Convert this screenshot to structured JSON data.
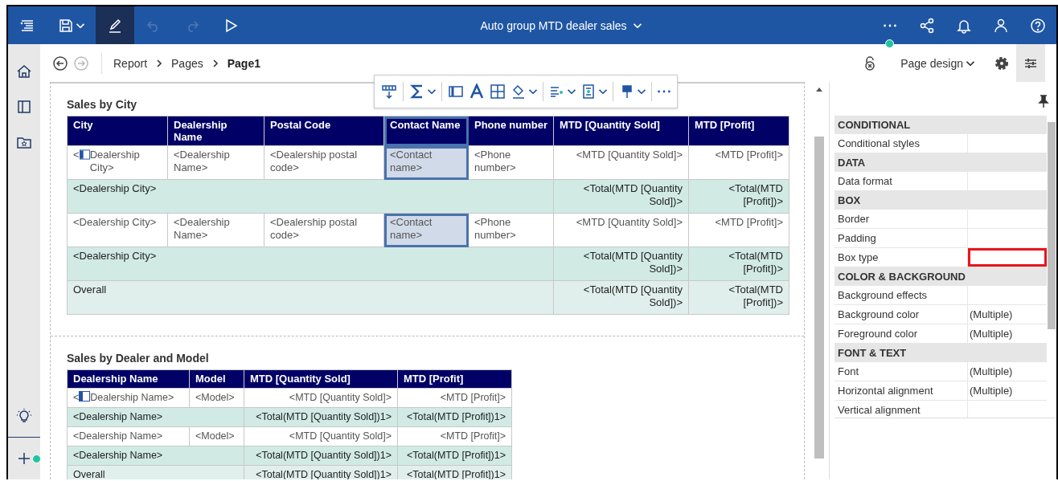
{
  "app_bar": {
    "buttons": [
      {
        "kind": "menu",
        "selected": false,
        "disabled": false
      },
      {
        "kind": "save",
        "selected": false,
        "disabled": false
      },
      {
        "kind": "edit",
        "selected": true,
        "disabled": false
      },
      {
        "kind": "undo",
        "selected": false,
        "disabled": true
      },
      {
        "kind": "redo",
        "selected": false,
        "disabled": true
      },
      {
        "kind": "run",
        "selected": false,
        "disabled": false
      }
    ],
    "title": "Auto group MTD dealer sales",
    "actions": [
      {
        "kind": "more",
        "badge": true
      },
      {
        "kind": "share",
        "badge": false
      },
      {
        "kind": "notifications",
        "badge": false
      },
      {
        "kind": "user",
        "badge": false
      },
      {
        "kind": "help",
        "badge": false
      }
    ]
  },
  "rail": [
    {
      "kind": "home",
      "badge": false
    },
    {
      "kind": "panel",
      "badge": false
    },
    {
      "kind": "folder",
      "badge": false
    },
    {
      "kind": "tip",
      "badge": false
    },
    {
      "kind": "add",
      "badge": true
    }
  ],
  "breadcrumb": {
    "back_disabled": false,
    "forward_disabled": true,
    "items": [
      {
        "label": "Report",
        "current": false
      },
      {
        "label": "Pages",
        "current": false
      },
      {
        "label": "Page1",
        "current": true
      }
    ]
  },
  "view_mode": "Page design",
  "tools": [
    {
      "kind": "unlock",
      "selected": false
    },
    {
      "kind": "settings",
      "selected": false
    },
    {
      "kind": "properties",
      "selected": true
    }
  ],
  "tables": [
    {
      "title": "Sales by City",
      "columns": [
        {
          "label": "City",
          "kind": "attribute",
          "selected": false
        },
        {
          "label": "Dealership Name",
          "kind": "attribute",
          "selected": false
        },
        {
          "label": "Postal Code",
          "kind": "attribute",
          "selected": false
        },
        {
          "label": "Contact Name",
          "kind": "attribute",
          "selected": true
        },
        {
          "label": "Phone number",
          "kind": "attribute",
          "selected": false
        },
        {
          "label": "MTD [Quantity Sold]",
          "kind": "measure",
          "selected": false
        },
        {
          "label": "MTD [Profit]",
          "kind": "measure",
          "selected": false
        }
      ],
      "rows": [
        {
          "kind": "detail",
          "cells": [
            {
              "prefix": "<",
              "text": "Dealership City>"
            },
            {
              "text": "<Dealership Name>"
            },
            {
              "text": "<Dealership postal code>"
            },
            {
              "text": "<Contact name>"
            },
            {
              "text": "<Phone number>"
            },
            {
              "text": "<MTD [Quantity Sold]>"
            },
            {
              "text": "<MTD [Profit]>"
            }
          ]
        },
        {
          "kind": "group",
          "label": "<Dealership City>",
          "totals": [
            "<Total(MTD [Quantity Sold])>",
            "<Total(MTD [Profit])>"
          ]
        },
        {
          "kind": "detail",
          "cells": [
            {
              "text": "<Dealership City>"
            },
            {
              "text": "<Dealership Name>"
            },
            {
              "text": "<Dealership postal code>"
            },
            {
              "text": "<Contact name>"
            },
            {
              "text": "<Phone number>"
            },
            {
              "text": "<MTD [Quantity Sold]>"
            },
            {
              "text": "<MTD [Profit]>"
            }
          ]
        },
        {
          "kind": "group",
          "label": "<Dealership City>",
          "totals": [
            "<Total(MTD [Quantity Sold])>",
            "<Total(MTD [Profit])>"
          ]
        },
        {
          "kind": "overall",
          "label": "Overall",
          "totals": [
            "<Total(MTD [Quantity Sold])>",
            "<Total(MTD [Profit])>"
          ]
        }
      ]
    },
    {
      "title": "Sales by Dealer and Model",
      "columns": [
        {
          "label": "Dealership Name",
          "kind": "attribute",
          "selected": false
        },
        {
          "label": "Model",
          "kind": "attribute",
          "selected": false
        },
        {
          "label": "MTD [Quantity Sold]",
          "kind": "measure",
          "selected": false
        },
        {
          "label": "MTD [Profit]",
          "kind": "measure",
          "selected": false
        }
      ],
      "rows": [
        {
          "kind": "detail",
          "cells": [
            {
              "prefix": "<",
              "text": "Dealership Name>"
            },
            {
              "text": "<Model>"
            },
            {
              "text": "<MTD [Quantity Sold]>"
            },
            {
              "text": "<MTD [Profit]>"
            }
          ]
        },
        {
          "kind": "group",
          "label": "<Dealership Name>",
          "totals": [
            "<Total(MTD [Quantity Sold])1>",
            "<Total(MTD [Profit])1>"
          ]
        },
        {
          "kind": "detail",
          "cells": [
            {
              "text": "<Dealership Name>"
            },
            {
              "text": "<Model>"
            },
            {
              "text": "<MTD [Quantity Sold]>"
            },
            {
              "text": "<MTD [Profit]>"
            }
          ]
        },
        {
          "kind": "group",
          "label": "<Dealership Name>",
          "totals": [
            "<Total(MTD [Quantity Sold])1>",
            "<Total(MTD [Profit])1>"
          ]
        },
        {
          "kind": "overall",
          "label": "Overall",
          "totals": [
            "<Total(MTD [Quantity Sold])1>",
            "<Total(MTD [Profit])1>"
          ]
        }
      ]
    }
  ],
  "properties": {
    "sections": [
      {
        "title": "CONDITIONAL",
        "rows": [
          {
            "name": "Conditional styles",
            "highlighted": false
          }
        ]
      },
      {
        "title": "DATA",
        "rows": [
          {
            "name": "Data format",
            "highlighted": false
          }
        ]
      },
      {
        "title": "BOX",
        "rows": [
          {
            "name": "Border",
            "highlighted": false
          },
          {
            "name": "Padding",
            "highlighted": false
          },
          {
            "name": "Box type",
            "highlighted": true
          }
        ]
      },
      {
        "title": "COLOR & BACKGROUND",
        "rows": [
          {
            "name": "Background effects",
            "highlighted": false
          },
          {
            "name": "Background color",
            "value": "(Multiple)",
            "highlighted": false
          },
          {
            "name": "Foreground color",
            "value": "(Multiple)",
            "highlighted": false
          }
        ]
      },
      {
        "title": "FONT & TEXT",
        "rows": [
          {
            "name": "Font",
            "value": "(Multiple)",
            "highlighted": false
          },
          {
            "name": "Horizontal alignment",
            "value": "(Multiple)",
            "highlighted": false
          },
          {
            "name": "Vertical alignment",
            "highlighted": false
          }
        ]
      }
    ]
  }
}
